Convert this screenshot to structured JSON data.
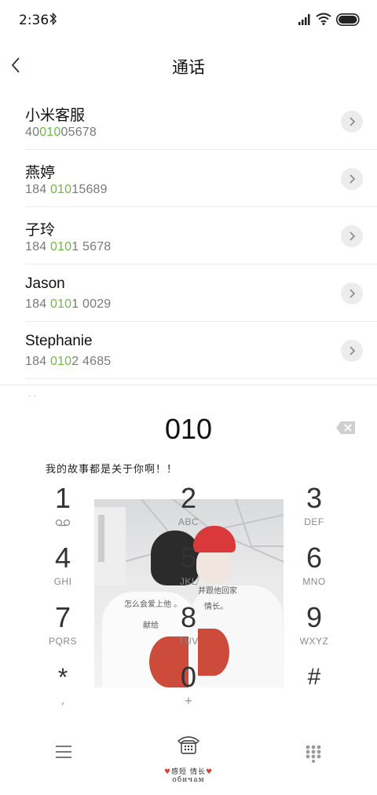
{
  "status_bar": {
    "time": "2:36",
    "icons": [
      "bluetooth-icon",
      "signal-icon",
      "wifi-icon",
      "battery-icon"
    ]
  },
  "header": {
    "title": "通话",
    "back_icon": "chevron-left-icon"
  },
  "contacts": [
    {
      "name": "小米客服",
      "number_parts": [
        "40",
        "010",
        "05678"
      ]
    },
    {
      "name": "燕婷",
      "number_parts": [
        "184 ",
        "010",
        "15689"
      ]
    },
    {
      "name": "子玲",
      "number_parts": [
        "184 ",
        "010",
        "1 5678"
      ]
    },
    {
      "name": "Jason",
      "number_parts": [
        "184 ",
        "010",
        "1 0029"
      ]
    },
    {
      "name": "Stephanie",
      "number_parts": [
        "184 ",
        "010",
        "2 4685"
      ]
    }
  ],
  "dialpad": {
    "input": "010",
    "wallpaper_caption": "我的故事都是关于你啊！！",
    "wallpaper_text_left": "怎么会爱上他 。",
    "wallpaper_text_left_2": "献给",
    "wallpaper_text_right": "并跟他回家",
    "wallpaper_text_right_2": "情长。",
    "keys": [
      {
        "digit": "1",
        "letters": ""
      },
      {
        "digit": "2",
        "letters": "ABC"
      },
      {
        "digit": "3",
        "letters": "DEF"
      },
      {
        "digit": "4",
        "letters": "GHI"
      },
      {
        "digit": "5",
        "letters": "JKL"
      },
      {
        "digit": "6",
        "letters": "MNO"
      },
      {
        "digit": "7",
        "letters": "PQRS"
      },
      {
        "digit": "8",
        "letters": "TUV"
      },
      {
        "digit": "9",
        "letters": "WXYZ"
      },
      {
        "digit": "*",
        "letters": ","
      },
      {
        "digit": "0",
        "letters": "+"
      },
      {
        "digit": "#",
        "letters": ""
      }
    ]
  },
  "bottom_bar": {
    "dial_label_1": "感短",
    "dial_label_2": "情长",
    "dial_label_3": "обичам"
  },
  "colors": {
    "match_highlight": "#6abf3c",
    "accent_red": "#cc4b3b"
  }
}
